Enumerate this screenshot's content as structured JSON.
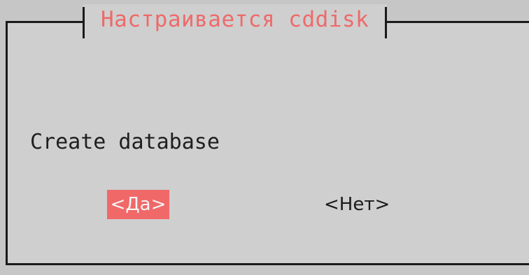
{
  "dialog": {
    "title": "Настраивается cddisk",
    "question": "Create database",
    "buttons": {
      "yes_label": "<Да>",
      "no_label": "<Нет>"
    }
  },
  "colors": {
    "background": "#cfcfcf",
    "title": "#ee6a6a",
    "selected_button_bg": "#f06868",
    "border": "#1a1a1a"
  }
}
